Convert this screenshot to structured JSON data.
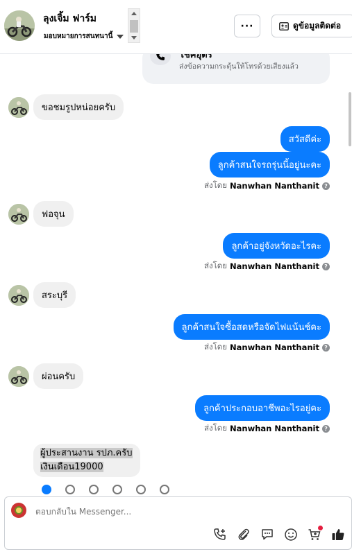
{
  "header": {
    "name": "ลุงเจิ้ม ฟาร์ม",
    "assigned": "มอบหมายการสนทนานี้",
    "more_label": "···",
    "contact_label": "ดูข้อมูลติดต่อ"
  },
  "call_card": {
    "title": "โชคอุดร",
    "subtitle": "ส่งข้อความกระตุ้นให้โทรด้วยเสียงแล้ว"
  },
  "messages": {
    "in1": "ขอชมรูปหน่อยครับ",
    "out1": "สวัสดีค่ะ",
    "out2": "ลูกค้าสนใจรถรุ่นนี้อยู่นะคะ",
    "in2": "ฟอจุน",
    "out3": "ลูกค้าอยู่จังหวัดอะไรคะ",
    "in3": "สระบุรี",
    "out4": "ลูกค้าสนใจซื้อสดหรือจัดไฟแน้นช์คะ",
    "in4": "ผ่อนครับ",
    "out5": "ลูกค้าประกอบอาชีพอะไรอยู่คะ",
    "in5_line1": "ผู้ประสานงาน รปภ.ครับ",
    "in5_line2": "เงินเดือน19000"
  },
  "sent_by": {
    "prefix": "ส่งโดย",
    "name": "Nanwhan Nanthanit"
  },
  "composer": {
    "placeholder": "ตอบกลับใน Messenger..."
  },
  "colors": {
    "accent": "#0a7cff",
    "incoming_bubble": "#f0f0f0",
    "notification_dot": "#e41e3f"
  },
  "icons": {
    "call": "phone-plus-icon",
    "attach": "paperclip-icon",
    "saved_reply": "chat-bubble-icon",
    "emoji": "smiley-icon",
    "shop": "cart-plus-icon",
    "like": "thumbs-up-icon"
  }
}
